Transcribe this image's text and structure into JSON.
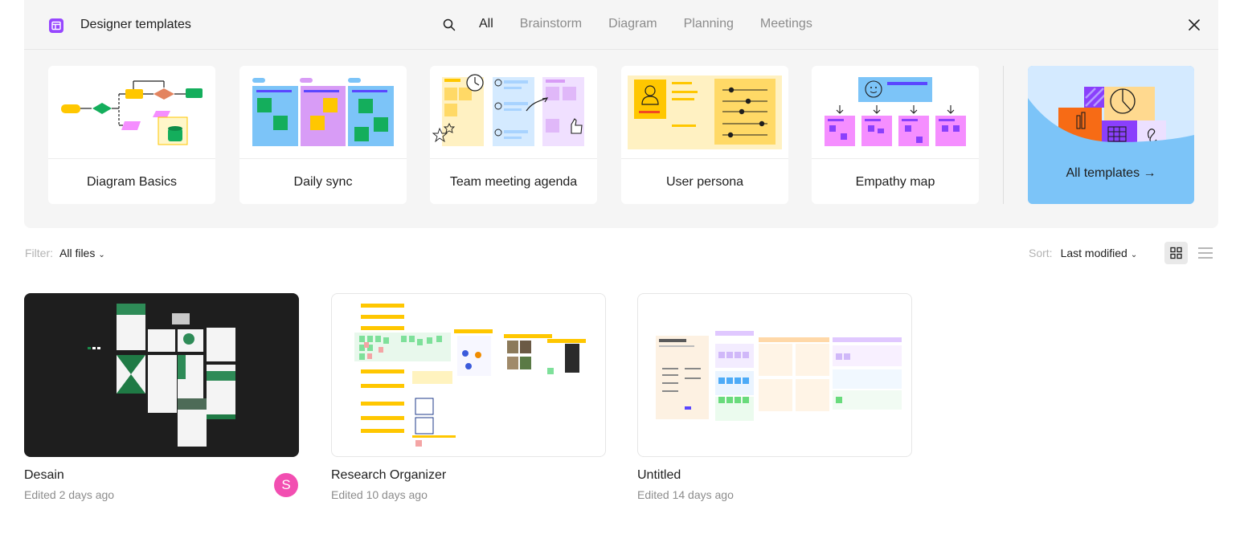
{
  "panel": {
    "title": "Designer templates",
    "icon": "template-icon",
    "tabs": [
      {
        "label": "All",
        "active": true
      },
      {
        "label": "Brainstorm",
        "active": false
      },
      {
        "label": "Diagram",
        "active": false
      },
      {
        "label": "Planning",
        "active": false
      },
      {
        "label": "Meetings",
        "active": false
      }
    ],
    "templates": [
      {
        "label": "Diagram Basics"
      },
      {
        "label": "Daily sync"
      },
      {
        "label": "Team meeting agenda"
      },
      {
        "label": "User persona"
      },
      {
        "label": "Empathy map"
      }
    ],
    "all_templates_label": "All templates →"
  },
  "toolbar": {
    "filter_label": "Filter:",
    "filter_value": "All files",
    "sort_label": "Sort:",
    "sort_value": "Last modified",
    "view_mode": "grid"
  },
  "files": [
    {
      "name": "Desain",
      "edited": "Edited 2 days ago",
      "avatar_initial": "S",
      "avatar_color": "#f24eb1"
    },
    {
      "name": "Research Organizer",
      "edited": "Edited 10 days ago"
    },
    {
      "name": "Untitled",
      "edited": "Edited 14 days ago"
    }
  ],
  "colors": {
    "accent": "#9747ff",
    "panel_bg": "#f5f5f5",
    "all_templates_bg": "#7cc4f8"
  }
}
